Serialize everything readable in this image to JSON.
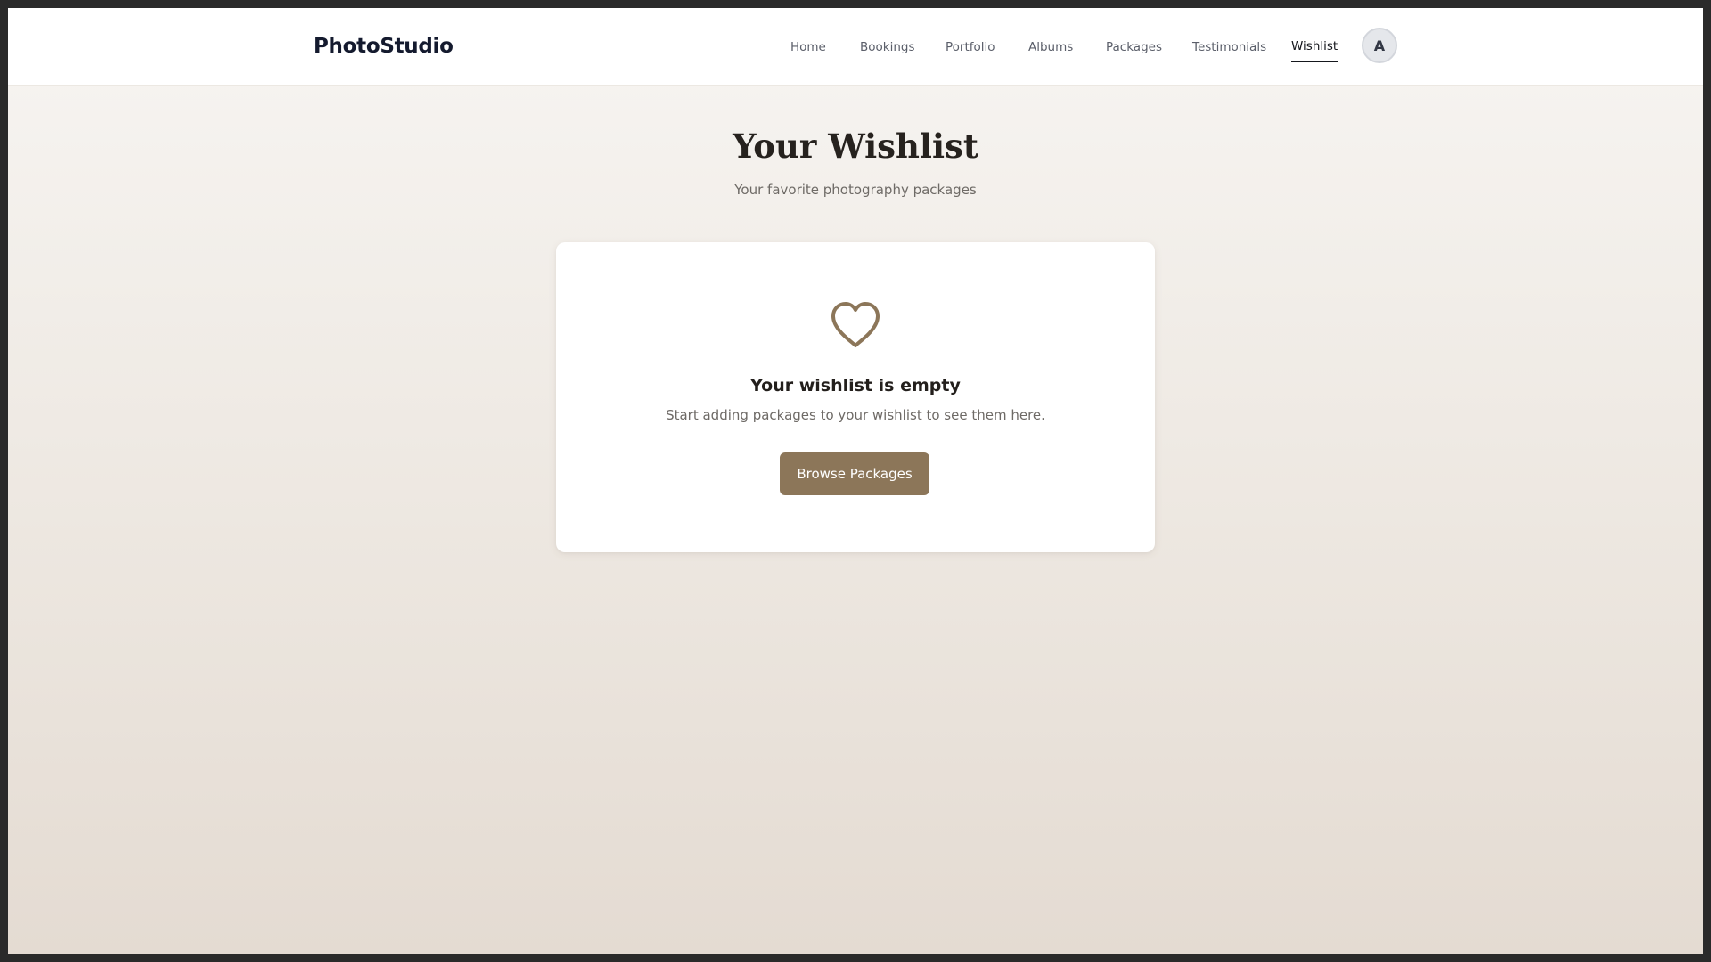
{
  "header": {
    "brand": "PhotoStudio",
    "nav": [
      {
        "label": "Home"
      },
      {
        "label": "Bookings"
      },
      {
        "label": "Portfolio"
      },
      {
        "label": "Albums"
      },
      {
        "label": "Packages"
      },
      {
        "label": "Testimonials"
      },
      {
        "label": "Wishlist",
        "active": true
      }
    ],
    "avatar_initial": "A"
  },
  "main": {
    "title": "Your Wishlist",
    "subtitle": "Your favorite photography packages"
  },
  "empty_state": {
    "icon": "heart-icon",
    "title": "Your wishlist is empty",
    "text": "Start adding packages to your wishlist to see them here.",
    "button_label": "Browse Packages"
  },
  "colors": {
    "accent": "#8c7659",
    "brand_text": "#141a2e"
  }
}
